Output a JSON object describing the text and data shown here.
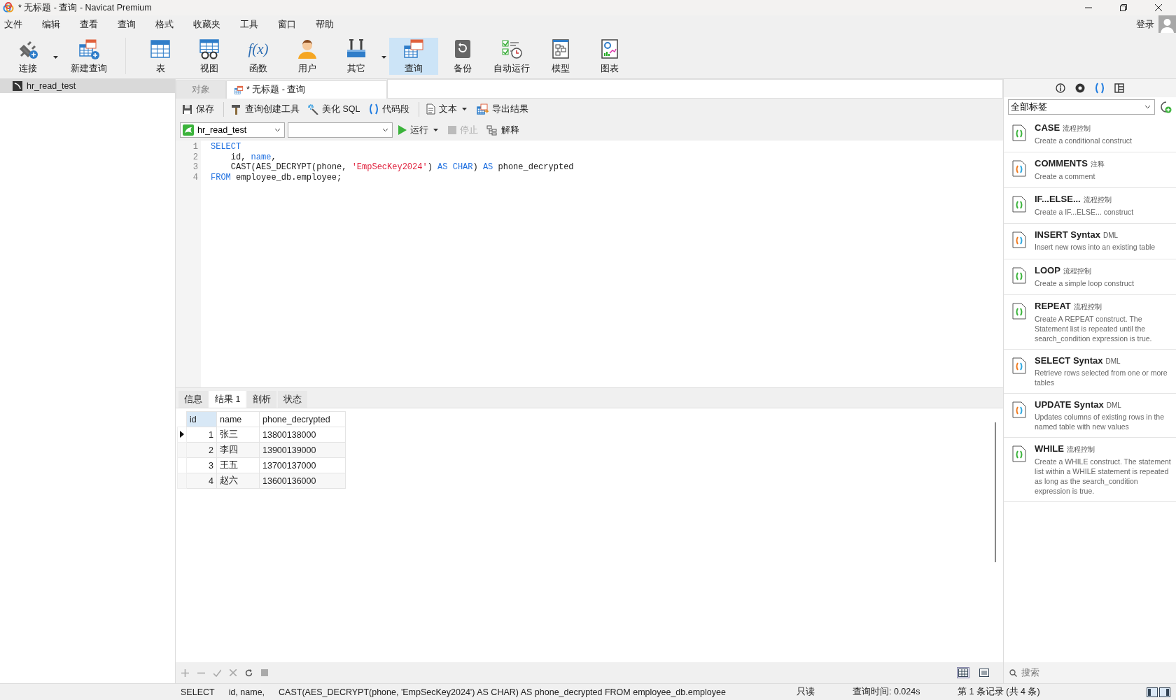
{
  "window": {
    "title": "* 无标题 - 查询 - Navicat Premium"
  },
  "menu": [
    "文件",
    "编辑",
    "查看",
    "查询",
    "格式",
    "收藏夹",
    "工具",
    "窗口",
    "帮助"
  ],
  "account": {
    "label": "登录"
  },
  "toolbar": [
    {
      "kind": "connect",
      "label": "连接",
      "dropdown": true,
      "selected": false
    },
    {
      "kind": "new_query",
      "label": "新建查询",
      "dropdown": false,
      "selected": false
    },
    {
      "kind": "table",
      "label": "表",
      "dropdown": false,
      "selected": false
    },
    {
      "kind": "view",
      "label": "视图",
      "dropdown": false,
      "selected": false
    },
    {
      "kind": "function",
      "label": "函数",
      "icon_text": "f(x)",
      "dropdown": false,
      "selected": false
    },
    {
      "kind": "user",
      "label": "用户",
      "dropdown": false,
      "selected": false
    },
    {
      "kind": "other",
      "label": "其它",
      "dropdown": true,
      "selected": false
    },
    {
      "kind": "query",
      "label": "查询",
      "dropdown": false,
      "selected": true
    },
    {
      "kind": "backup",
      "label": "备份",
      "dropdown": false,
      "selected": false
    },
    {
      "kind": "automation",
      "label": "自动运行",
      "dropdown": false,
      "selected": false
    },
    {
      "kind": "model",
      "label": "模型",
      "dropdown": false,
      "selected": false
    },
    {
      "kind": "chart",
      "label": "图表",
      "dropdown": false,
      "selected": false
    }
  ],
  "sidebar": {
    "items": [
      {
        "label": "hr_read_test",
        "selected": true
      }
    ]
  },
  "tabs": [
    {
      "kind": "objects",
      "label": "对象",
      "selected": false
    },
    {
      "kind": "query",
      "label": "* 无标题 - 查询",
      "selected": true
    }
  ],
  "query_toolbar": [
    {
      "kind": "save",
      "label": "保存",
      "separator_before": false,
      "dropdown": false
    },
    {
      "kind": "builder",
      "label": "查询创建工具",
      "separator_before": true,
      "dropdown": false
    },
    {
      "kind": "beautify",
      "label": "美化 SQL",
      "separator_before": false,
      "dropdown": false
    },
    {
      "kind": "snippet",
      "label": "代码段",
      "separator_before": false,
      "dropdown": false
    },
    {
      "kind": "text",
      "label": "文本",
      "separator_before": true,
      "dropdown": true
    },
    {
      "kind": "export",
      "label": "导出结果",
      "separator_before": false,
      "dropdown": false
    }
  ],
  "connection_select": {
    "value": "hr_read_test"
  },
  "run_controls": [
    {
      "kind": "run",
      "label": "运行",
      "dropdown": true,
      "disabled": false
    },
    {
      "kind": "stop",
      "label": "停止",
      "dropdown": false,
      "disabled": true
    },
    {
      "kind": "explain",
      "label": "解释",
      "dropdown": false,
      "disabled": false
    }
  ],
  "editor": {
    "lines": [
      {
        "number": "1",
        "tokens": [
          {
            "kind": "keyword",
            "text": "SELECT"
          }
        ]
      },
      {
        "number": "2",
        "tokens": [
          {
            "kind": "plain",
            "text": "    id, "
          },
          {
            "kind": "keyword",
            "text": "name"
          },
          {
            "kind": "plain",
            "text": ","
          }
        ]
      },
      {
        "number": "3",
        "tokens": [
          {
            "kind": "plain",
            "text": "    CAST(AES_DECRYPT(phone, "
          },
          {
            "kind": "string",
            "text": "'EmpSecKey2024'"
          },
          {
            "kind": "plain",
            "text": ") "
          },
          {
            "kind": "keyword",
            "text": "AS CHAR"
          },
          {
            "kind": "plain",
            "text": ") "
          },
          {
            "kind": "keyword",
            "text": "AS"
          },
          {
            "kind": "plain",
            "text": " phone_decrypted"
          }
        ]
      },
      {
        "number": "4",
        "tokens": [
          {
            "kind": "keyword",
            "text": "FROM"
          },
          {
            "kind": "plain",
            "text": " employee_db.employee;"
          }
        ]
      }
    ]
  },
  "result_tabs": [
    {
      "label": "信息",
      "selected": false
    },
    {
      "label": "结果 1",
      "selected": true
    },
    {
      "label": "剖析",
      "selected": false
    },
    {
      "label": "状态",
      "selected": false
    }
  ],
  "result_grid": {
    "columns": [
      {
        "label": "id",
        "numeric": true,
        "selected": true
      },
      {
        "label": "name",
        "numeric": false,
        "selected": false
      },
      {
        "label": "phone_decrypted",
        "numeric": false,
        "selected": false
      }
    ],
    "rows": [
      {
        "selected": true,
        "cells": [
          "1",
          "张三",
          "13800138000"
        ]
      },
      {
        "selected": false,
        "cells": [
          "2",
          "李四",
          "13900139000"
        ]
      },
      {
        "selected": false,
        "cells": [
          "3",
          "王五",
          "13700137000"
        ]
      },
      {
        "selected": false,
        "cells": [
          "4",
          "赵六",
          "13600136000"
        ]
      }
    ]
  },
  "view_modes": [
    {
      "kind": "grid",
      "selected": true
    },
    {
      "kind": "form",
      "selected": false
    }
  ],
  "right_panel": {
    "tabs": [
      {
        "kind": "info",
        "selected": false
      },
      {
        "kind": "preview",
        "selected": false
      },
      {
        "kind": "snippets",
        "selected": true
      },
      {
        "kind": "layout",
        "selected": false
      }
    ],
    "tag_filter": {
      "value": "全部标签"
    },
    "snippets": [
      {
        "kind": "flow",
        "title": "CASE",
        "tag": "流程控制",
        "description": "Create a conditional construct"
      },
      {
        "kind": "syntax",
        "title": "COMMENTS",
        "tag": "注释",
        "description": "Create a comment"
      },
      {
        "kind": "flow",
        "title": "IF...ELSE...",
        "tag": "流程控制",
        "description": "Create a IF...ELSE... construct"
      },
      {
        "kind": "syntax",
        "title": "INSERT Syntax",
        "tag": "DML",
        "description": "Insert new rows into an existing table"
      },
      {
        "kind": "flow",
        "title": "LOOP",
        "tag": "流程控制",
        "description": "Create a simple loop construct"
      },
      {
        "kind": "flow",
        "title": "REPEAT",
        "tag": "流程控制",
        "description": "Create A REPEAT construct. The Statement list is repeated until the search_condition expression is true."
      },
      {
        "kind": "syntax",
        "title": "SELECT Syntax",
        "tag": "DML",
        "description": "Retrieve rows selected from one or more tables"
      },
      {
        "kind": "syntax",
        "title": "UPDATE Syntax",
        "tag": "DML",
        "description": "Updates columns of existing rows in the named table with new values"
      },
      {
        "kind": "flow",
        "title": "WHILE",
        "tag": "流程控制",
        "description": "Create a WHILE construct. The statement list within a WHILE statement is repeated as long as the search_condition expression is true."
      }
    ],
    "search": {
      "placeholder": "搜索"
    }
  },
  "status_bar": {
    "sql_parts": [
      "SELECT",
      "id, name,",
      "CAST(AES_DECRYPT(phone, 'EmpSecKey2024') AS CHAR) AS phone_decrypted FROM employee_db.employee"
    ],
    "mode": "只读",
    "query_time": "查询时间: 0.024s",
    "record": "第 1 条记录 (共 4 条)"
  }
}
